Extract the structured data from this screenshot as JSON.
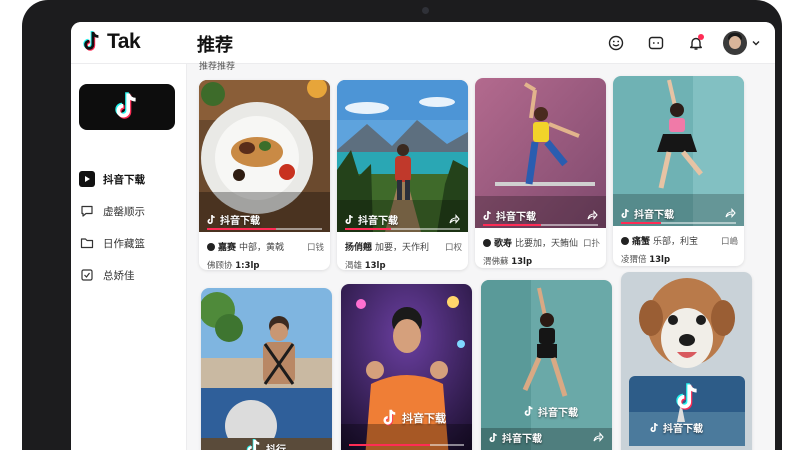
{
  "app": {
    "logo_text": "Tak",
    "page_title": "推荐"
  },
  "top_icons": [
    "smile-icon",
    "message-icon",
    "bell-icon",
    "avatar",
    "chevron-down-icon"
  ],
  "sidebar": {
    "items": [
      {
        "label": "抖音下载",
        "icon": "play-icon"
      },
      {
        "label": "虚罄顺示",
        "icon": "chat-icon"
      },
      {
        "label": "日作藏篮",
        "icon": "folder-icon"
      },
      {
        "label": "总娇佳",
        "icon": "check-square-icon"
      }
    ]
  },
  "section_label": "推荐推荐",
  "cards": [
    {
      "badge": "抖音下载",
      "author": "嘉赛",
      "subtitle": "中部，黄戟",
      "count": "口钱",
      "stats_prefix": "佛顾协",
      "stats_value": "1:3lp"
    },
    {
      "badge": "抖音下载",
      "author": "扬俏翹",
      "subtitle": "加要，天作利",
      "count": "口权",
      "stats_prefix": "渴雄",
      "stats_value": "13lp"
    },
    {
      "badge": "抖音下载",
      "author": "歌寿",
      "subtitle": "比要加，天鲔仙",
      "count": "口扑",
      "stats_prefix": "渭佛蘇",
      "stats_value": "13lp"
    },
    {
      "badge": "抖音下载",
      "author": "痛蟹",
      "subtitle": "乐部，利宝",
      "count": "口嶋",
      "stats_prefix": "凌猬倍",
      "stats_value": "13lp"
    },
    {
      "badge": "抖行"
    },
    {
      "badge": "抖音下载"
    },
    {
      "badge": "抖音下载"
    },
    {
      "badge": "抖音下载"
    }
  ],
  "progress": [
    0.6,
    0.4,
    0.5,
    0.35,
    0.0,
    0.7,
    0.0,
    0.0
  ],
  "colors": {
    "accent_red": "#fe2c55",
    "accent_cyan": "#25f4ee"
  }
}
